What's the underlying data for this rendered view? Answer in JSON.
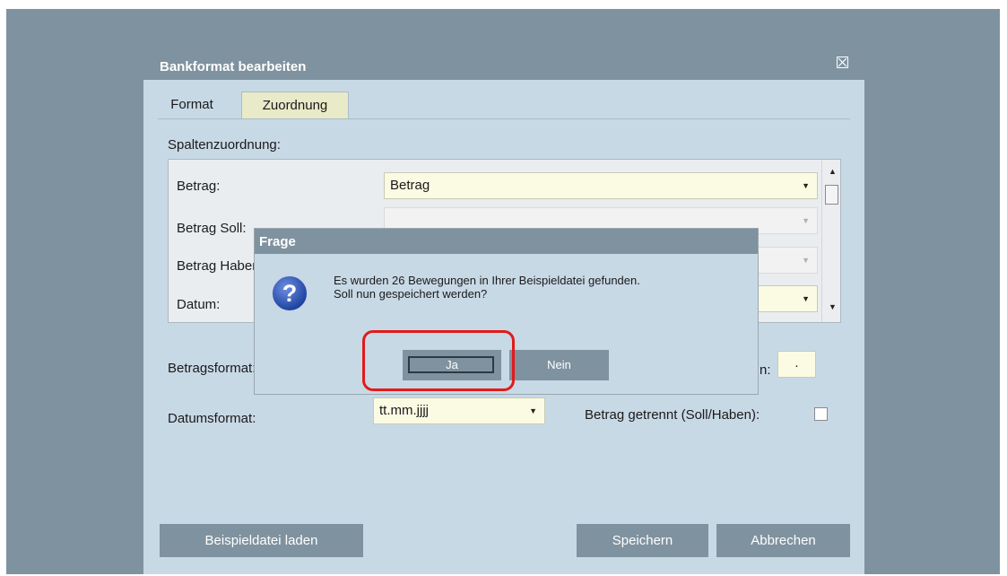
{
  "window": {
    "title": "Bankformat bearbeiten",
    "close_icon": "close-box-icon"
  },
  "tabs": [
    {
      "label": "Format",
      "active": false
    },
    {
      "label": "Zuordnung",
      "active": true
    }
  ],
  "mapping": {
    "heading": "Spaltenzuordnung:",
    "rows": [
      {
        "label": "Betrag:",
        "value": "Betrag",
        "enabled": true
      },
      {
        "label": "Betrag Soll:",
        "value": "",
        "enabled": false
      },
      {
        "label": "Betrag Haben:",
        "value": "",
        "enabled": false
      },
      {
        "label": "Datum:",
        "value": "",
        "enabled": true
      }
    ]
  },
  "betragsformat": {
    "label": "Betragsformat:",
    "decimal_label": "n:",
    "decimal_value": "."
  },
  "datumsformat": {
    "label": "Datumsformat:",
    "value": "tt.mm.jjjj"
  },
  "betrag_getrennt": {
    "label": "Betrag getrennt (Soll/Haben):",
    "checked": false
  },
  "footer": {
    "load_sample": "Beispieldatei laden",
    "save": "Speichern",
    "cancel": "Abbrechen"
  },
  "dialog": {
    "title": "Frage",
    "icon": "question-icon",
    "message_line1": "Es wurden 26 Bewegungen in Ihrer Beispieldatei gefunden.",
    "message_line2": "Soll nun gespeichert werden?",
    "yes": "Ja",
    "no": "Nein"
  },
  "colors": {
    "highlight": "#e21a1a",
    "accent": "#7f929f",
    "panel": "#c8d9e6"
  }
}
